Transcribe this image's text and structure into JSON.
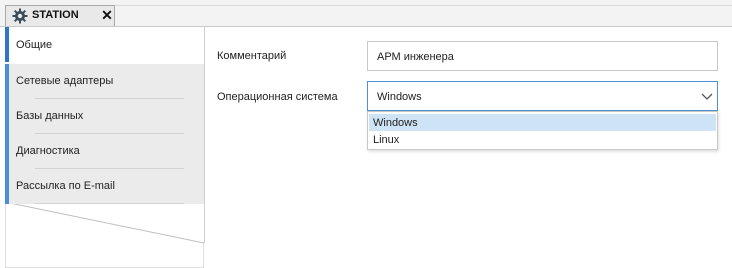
{
  "tab": {
    "title": "STATION",
    "icon": "gear-icon",
    "close": "✕"
  },
  "sidebar": {
    "items": [
      {
        "label": "Общие",
        "active": true
      },
      {
        "label": "Сетевые адаптеры",
        "active": false
      },
      {
        "label": "Базы данных",
        "active": false
      },
      {
        "label": "Диагностика",
        "active": false
      },
      {
        "label": "Рассылка по E-mail",
        "active": false
      }
    ]
  },
  "form": {
    "comment_label": "Комментарий",
    "comment_value": "АРМ инженера",
    "os_label": "Операционная система",
    "os_value": "Windows",
    "os_options": [
      "Windows",
      "Linux"
    ]
  },
  "colors": {
    "accent": "#2f76c9",
    "selection": "#cfe3f7",
    "focus_border": "#4f8fd6"
  }
}
